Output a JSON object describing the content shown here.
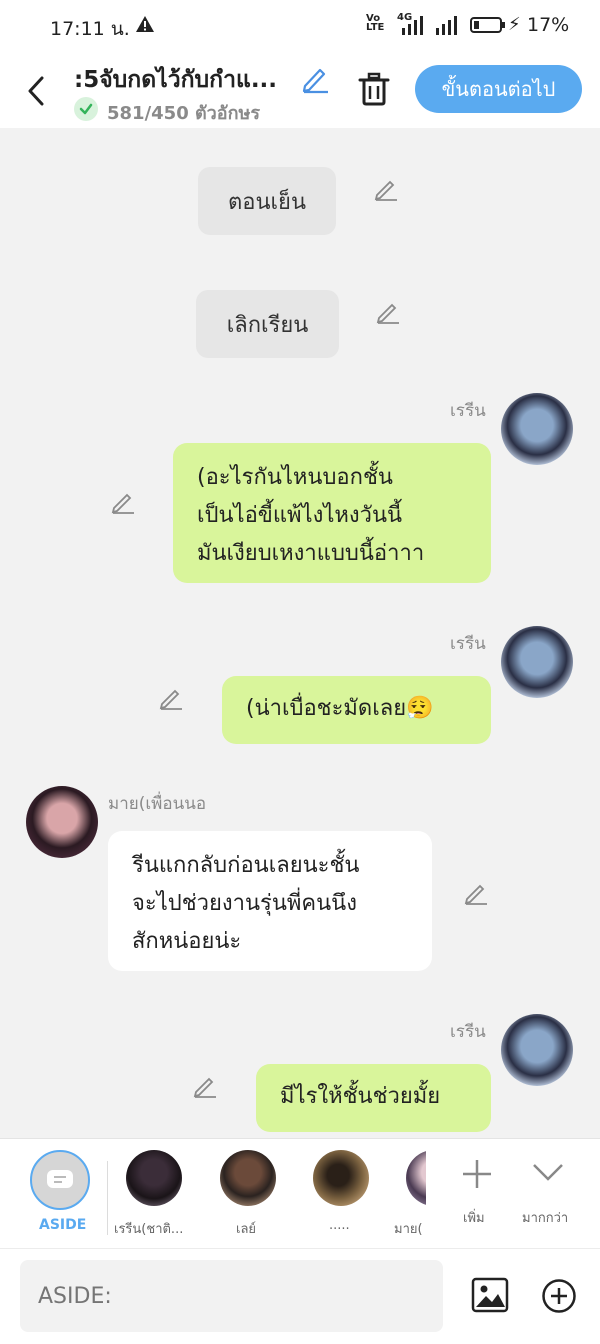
{
  "status_bar": {
    "time": "17:11 น.",
    "network_type": "4G",
    "battery_percent": "17%",
    "battery_level": 0.17,
    "icons": [
      "warning-icon",
      "volte-icon",
      "signal-icon",
      "battery-icon",
      "charging-icon"
    ]
  },
  "header": {
    "title": ":5จับกดไว้กับกำแ...",
    "char_count": "581/450 ตัวอักษร",
    "next_button": "ขั้นตอนต่อไป",
    "accent_color": "#5aaaf0"
  },
  "messages": [
    {
      "type": "narration",
      "text": "ตอนเย็น"
    },
    {
      "type": "narration",
      "text": "เลิกเรียน"
    },
    {
      "type": "right",
      "speaker": "เรรีน",
      "lines": [
        "(อะไรกันไหนบอกชั้น",
        "เป็นไอ่ขี้แพ้ไงไหงวันนี้",
        "มันเงียบเหงาแบบนี้อ่าาา"
      ]
    },
    {
      "type": "right",
      "speaker": "เรรีน",
      "lines": [
        "(น่าเบื่อชะมัดเลย😮‍💨"
      ]
    },
    {
      "type": "left",
      "speaker": "มาย(เพื่อนนอ",
      "lines": [
        "รีนแกกลับก่อนเลยนะชั้น",
        "จะไปช่วยงานรุ่นพี่คนนึง",
        "สักหน่อยน่ะ"
      ]
    },
    {
      "type": "right",
      "speaker": "เรรีน",
      "lines": [
        "มีไรให้ชั้นช่วยมั้ย"
      ]
    }
  ],
  "characters": [
    {
      "label": "ASIDE"
    },
    {
      "label": "เรรีน(ชาติ..."
    },
    {
      "label": "เลย์"
    },
    {
      "label": "....."
    },
    {
      "label": "มาย("
    }
  ],
  "bar_actions": {
    "add": "เพิ่ม",
    "more": "มากกว่า"
  },
  "composer": {
    "placeholder": "ASIDE:"
  },
  "colors": {
    "green_bubble": "#d9f59b",
    "white_bubble": "#ffffff",
    "narration": "#e6e6e6"
  }
}
